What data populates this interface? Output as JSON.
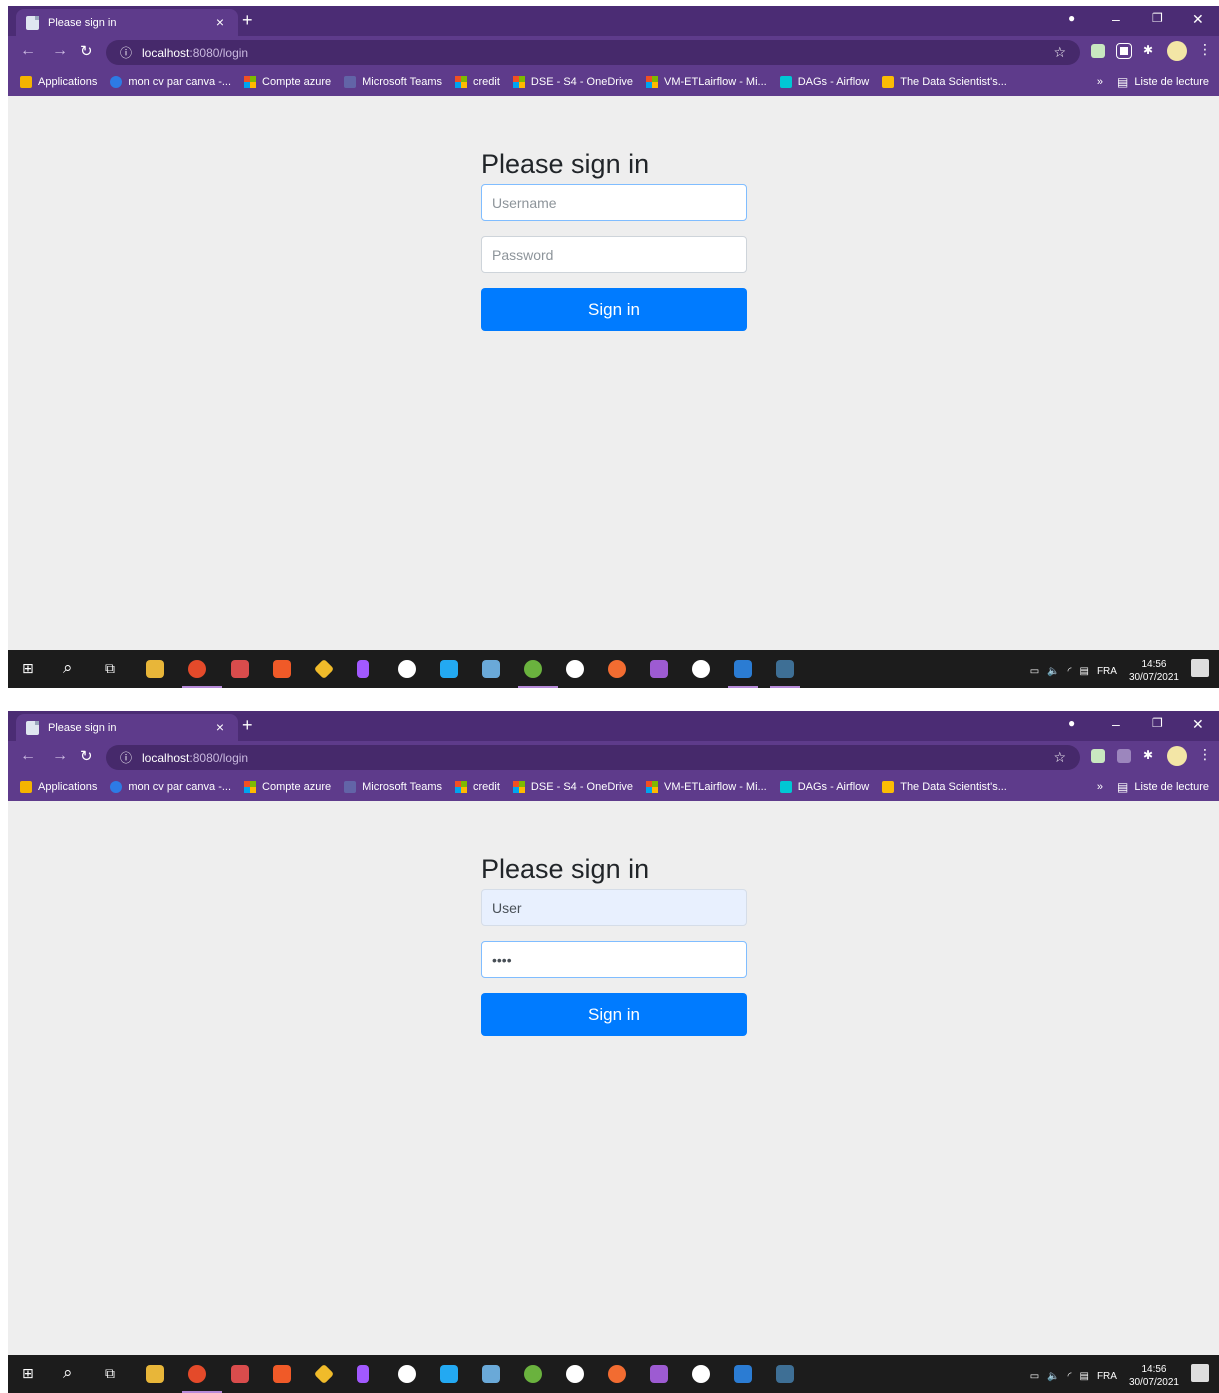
{
  "browser": {
    "tab_title": "Please sign in",
    "tab_close": "×",
    "new_tab": "+",
    "url_host": "localhost",
    "url_path": ":8080/login",
    "bookmarks": [
      {
        "label": "Applications",
        "icon": "apps-grid-icon",
        "color": "#f4b400"
      },
      {
        "label": "mon cv par canva -...",
        "icon": "canva-icon",
        "color": "#2d7be5"
      },
      {
        "label": "Compte azure",
        "icon": "microsoft-icon"
      },
      {
        "label": "Microsoft Teams",
        "icon": "teams-icon",
        "color": "#6264a7"
      },
      {
        "label": "credit",
        "icon": "microsoft-icon"
      },
      {
        "label": "DSE - S4 - OneDrive",
        "icon": "microsoft-icon"
      },
      {
        "label": "VM-ETLairflow - Mi...",
        "icon": "microsoft-icon"
      },
      {
        "label": "DAGs - Airflow",
        "icon": "airflow-icon",
        "color": "#00c7d4"
      },
      {
        "label": "The Data Scientist's...",
        "icon": "drive-icon",
        "color": "#fbbc04"
      }
    ],
    "bookmarks_more": "»",
    "reading_list": "Liste de lecture"
  },
  "screens": [
    {
      "heading": "Please sign in",
      "username": {
        "placeholder": "Username",
        "value": ""
      },
      "password": {
        "placeholder": "Password",
        "value": ""
      },
      "submit_label": "Sign in"
    },
    {
      "heading": "Please sign in",
      "username": {
        "placeholder": "Username",
        "value": "User"
      },
      "password": {
        "placeholder": "Password",
        "value": "••••"
      },
      "submit_label": "Sign in"
    }
  ],
  "taskbar": {
    "language": "FRA",
    "time": "14:56",
    "date": "30/07/2021",
    "notification_count": "1"
  },
  "colors": {
    "chrome_theme": "#5e3b8b",
    "page_background": "#eeeeee",
    "primary_button": "#007bff"
  }
}
